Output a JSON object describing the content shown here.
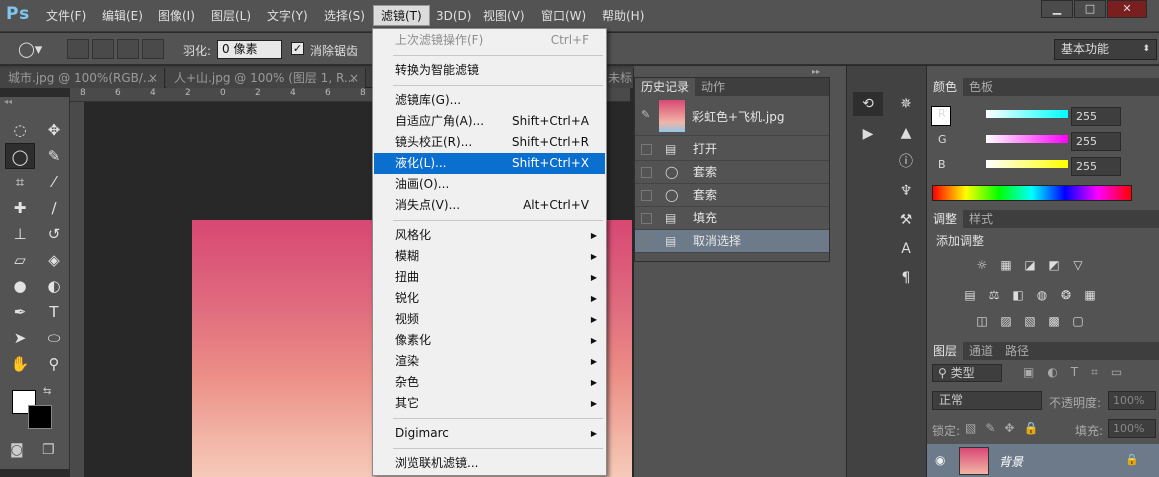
{
  "app": {
    "logo": "Ps",
    "workspace": "基本功能"
  },
  "menus": [
    "文件(F)",
    "编辑(E)",
    "图像(I)",
    "图层(L)",
    "文字(Y)",
    "选择(S)",
    "滤镜(T)",
    "3D(D)",
    "视图(V)",
    "窗口(W)",
    "帮助(H)"
  ],
  "window_controls": [
    "▁",
    "□",
    "✕"
  ],
  "options": {
    "feather_label": "羽化:",
    "feather_value": "0 像素",
    "antialias_label": "消除锯齿"
  },
  "doc_tabs": [
    "城市.jpg @ 100%(RGB/...",
    "人+山.jpg @ 100% (图层 1, R...",
    "未标..."
  ],
  "ruler_ticks": [
    "8",
    "6",
    "4",
    "2",
    "0",
    "2",
    "4",
    "6",
    "8"
  ],
  "filter_menu": {
    "items": [
      {
        "label": "上次滤镜操作(F)",
        "shortcut": "Ctrl+F",
        "disabled": true
      },
      {
        "label": "转换为智能滤镜",
        "shortcut": ""
      },
      {
        "label": "滤镜库(G)...",
        "shortcut": ""
      },
      {
        "label": "自适应广角(A)...",
        "shortcut": "Shift+Ctrl+A"
      },
      {
        "label": "镜头校正(R)...",
        "shortcut": "Shift+Ctrl+R"
      },
      {
        "label": "液化(L)...",
        "shortcut": "Shift+Ctrl+X",
        "highlight": true
      },
      {
        "label": "油画(O)...",
        "shortcut": ""
      },
      {
        "label": "消失点(V)...",
        "shortcut": "Alt+Ctrl+V"
      },
      {
        "label": "风格化",
        "submenu": true
      },
      {
        "label": "模糊",
        "submenu": true
      },
      {
        "label": "扭曲",
        "submenu": true
      },
      {
        "label": "锐化",
        "submenu": true
      },
      {
        "label": "视频",
        "submenu": true
      },
      {
        "label": "像素化",
        "submenu": true
      },
      {
        "label": "渲染",
        "submenu": true
      },
      {
        "label": "杂色",
        "submenu": true
      },
      {
        "label": "其它",
        "submenu": true
      },
      {
        "label": "Digimarc",
        "submenu": true
      },
      {
        "label": "浏览联机滤镜...",
        "shortcut": ""
      }
    ]
  },
  "history": {
    "tabs": [
      "历史记录",
      "动作"
    ],
    "snapshot": "彩虹色+飞机.jpg",
    "items": [
      {
        "label": "打开"
      },
      {
        "label": "套索"
      },
      {
        "label": "套索"
      },
      {
        "label": "填充"
      },
      {
        "label": "取消选择"
      }
    ]
  },
  "color": {
    "tabs": [
      "颜色",
      "色板"
    ],
    "channels": [
      {
        "name": "R",
        "value": "255",
        "color": "#00ffff"
      },
      {
        "name": "G",
        "value": "255",
        "color": "#ff00ff"
      },
      {
        "name": "B",
        "value": "255",
        "color": "#ffff00"
      }
    ]
  },
  "adjust": {
    "tabs": [
      "调整",
      "样式"
    ],
    "title": "添加调整"
  },
  "layers": {
    "tabs": [
      "图层",
      "通道",
      "路径"
    ],
    "kind": "类型",
    "blend": "正常",
    "opacity_label": "不透明度:",
    "opacity": "100%",
    "lock_label": "锁定:",
    "fill_label": "填充:",
    "fill": "100%",
    "layer_name": "背景"
  }
}
